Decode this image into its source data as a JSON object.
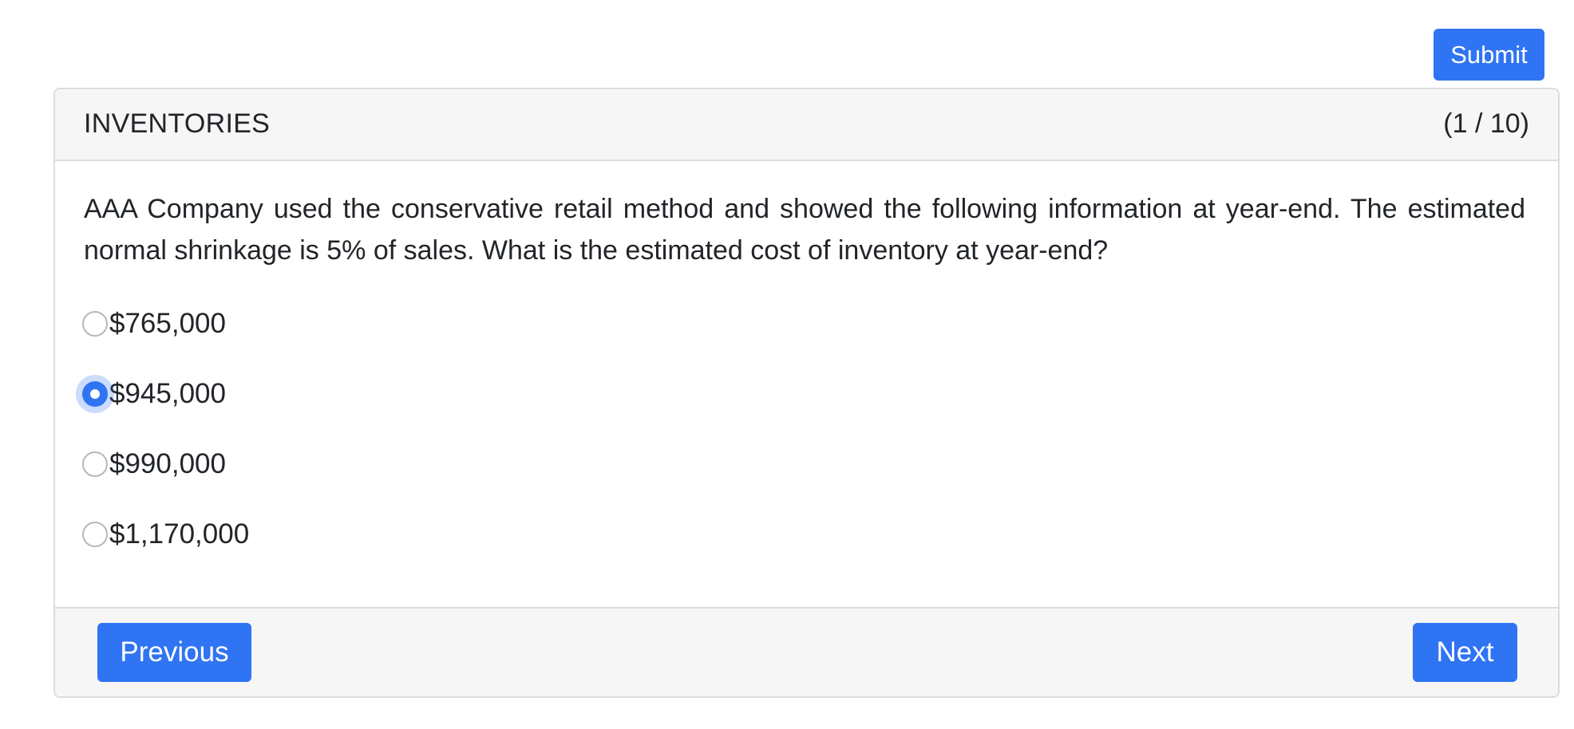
{
  "toolbar": {
    "submit_label": "Submit"
  },
  "card": {
    "title": "INVENTORIES",
    "progress": "(1 / 10)"
  },
  "question": {
    "text": "AAA Company used the conservative retail method and showed the following information at year-end. The estimated normal shrinkage is 5% of sales. What is the estimated cost of inventory at year-end?",
    "selected_index": 1,
    "options": [
      {
        "label": "$765,000",
        "checked": false
      },
      {
        "label": "$945,000",
        "checked": true
      },
      {
        "label": "$990,000",
        "checked": false
      },
      {
        "label": "$1,170,000",
        "checked": false
      }
    ]
  },
  "footer": {
    "previous_label": "Previous",
    "next_label": "Next"
  },
  "colors": {
    "accent": "#2f74f3",
    "header_bg": "#f6f6f6",
    "border": "#dcdcdc",
    "text": "#212529"
  }
}
